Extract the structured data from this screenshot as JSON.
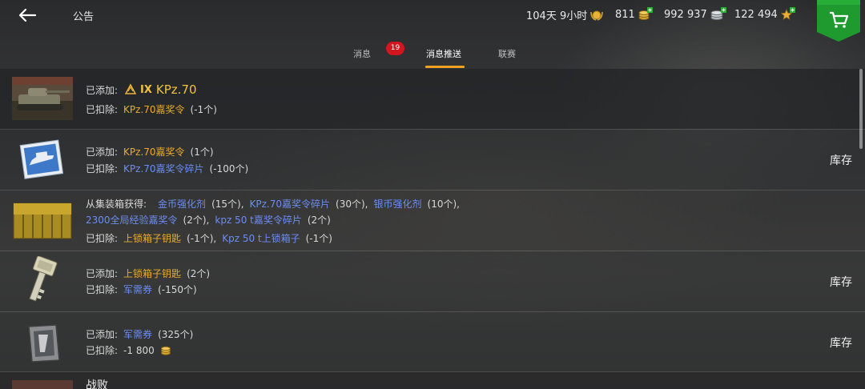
{
  "header": {
    "title": "公告",
    "premium_time": "104天 9小时",
    "gold": "811",
    "credits": "992 937",
    "free_xp": "122 494"
  },
  "tabs": [
    {
      "label": "消息",
      "badge": "19"
    },
    {
      "label": "消息推送"
    },
    {
      "label": "联赛"
    }
  ],
  "messages": [
    {
      "added_label": "已添加:",
      "added_tier": "IX",
      "added_tank": "KPz.70",
      "deducted_label": "已扣除:",
      "deducted_item": "KPz.70嘉奖令",
      "deducted_qty": "(-1个)"
    },
    {
      "added_label": "已添加:",
      "added_item": "KPz.70嘉奖令",
      "added_qty": "(1个)",
      "deducted_label": "已扣除:",
      "deducted_item": "KPz.70嘉奖令碎片",
      "deducted_qty": "(-100个)",
      "action": "库存"
    },
    {
      "from_label": "从集装箱获得:",
      "items": [
        {
          "name": "金币强化剂",
          "qty": "(15个)",
          "sep": ","
        },
        {
          "name": "KPz.70嘉奖令碎片",
          "qty": "(30个)",
          "sep": ","
        },
        {
          "name": "银币强化剂",
          "qty": "(10个)",
          "sep": ","
        },
        {
          "name": "2300全局经验嘉奖令",
          "qty": "(2个)",
          "sep": ","
        },
        {
          "name": "kpz 50 t嘉奖令碎片",
          "qty": "(2个)"
        }
      ],
      "deducted_label": "已扣除:",
      "deducted": [
        {
          "name": "上锁箱子钥匙",
          "qty": "(-1个)",
          "sep": ","
        },
        {
          "name": "Kpz 50 t上锁箱子",
          "qty": "(-1个)"
        }
      ]
    },
    {
      "added_label": "已添加:",
      "added_item": "上锁箱子钥匙",
      "added_qty": "(2个)",
      "deducted_label": "已扣除:",
      "deducted_item": "军需券",
      "deducted_qty": "(-150个)",
      "action": "库存"
    },
    {
      "added_label": "已添加:",
      "added_item": "军需券",
      "added_qty": "(325个)",
      "deducted_label": "已扣除:",
      "deducted_value": "-1 800",
      "action": "库存"
    },
    {
      "title": "战败"
    }
  ],
  "colors": {
    "gold_text": "#e9ac2b",
    "blue_text": "#6c8df2",
    "tab_accent": "#f0a020",
    "badge": "#d2151e",
    "shop_green": "#1f9a2e"
  },
  "icons": [
    "back-arrow-icon",
    "premium-laurel-icon",
    "gold-coins-icon",
    "silver-coins-icon",
    "free-xp-star-icon",
    "plus-icon",
    "shopping-cart-icon"
  ]
}
